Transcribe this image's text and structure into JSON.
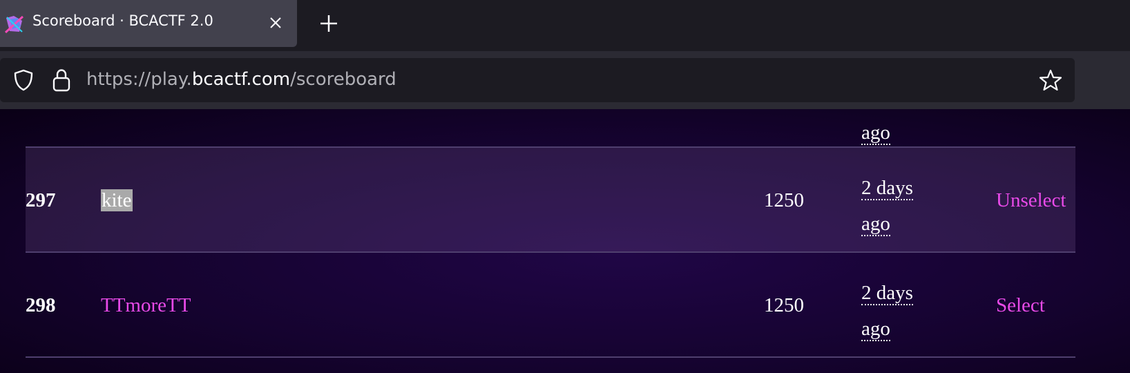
{
  "browser": {
    "tab": {
      "title": "Scoreboard · BCACTF 2.0",
      "favicon": "bcactf-favicon-icon"
    },
    "url": {
      "scheme": "https://play.",
      "host": "bcactf.com",
      "path": "/scoreboard"
    },
    "icons": {
      "shield": "shield-icon",
      "lock": "lock-icon",
      "star": "star-icon",
      "close": "close-icon",
      "new_tab": "plus-icon"
    }
  },
  "scoreboard": {
    "previous_row_time_tail": "ago",
    "rows": [
      {
        "rank": "297",
        "team": "kite",
        "score": "1250",
        "time_line1": "2 days",
        "time_line2": "ago",
        "action": "Unselect",
        "selected": true
      },
      {
        "rank": "298",
        "team": "TTmoreTT",
        "score": "1250",
        "time_line1": "2 days",
        "time_line2": "ago",
        "action": "Select",
        "selected": false
      }
    ]
  },
  "colors": {
    "accent_link": "#e84ae8",
    "tab_active_bg": "#42414d",
    "content_bg": "#15032f"
  }
}
